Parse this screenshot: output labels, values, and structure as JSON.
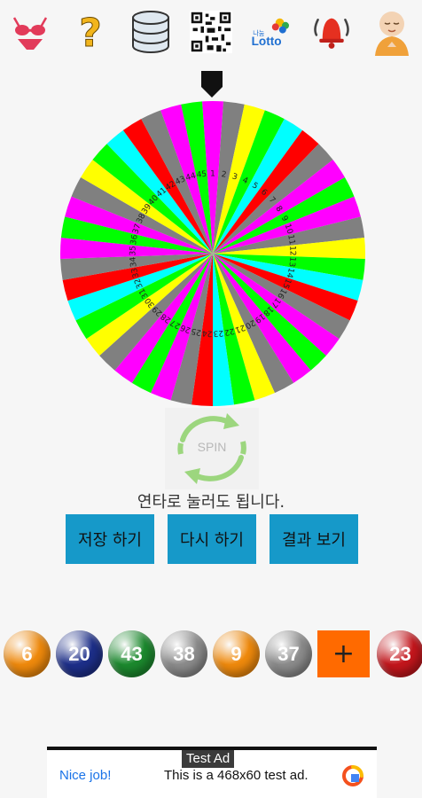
{
  "toolbar": {
    "items": [
      {
        "icon": "bikini-icon"
      },
      {
        "icon": "question-mark-icon"
      },
      {
        "icon": "database-icon"
      },
      {
        "icon": "qr-code-icon"
      },
      {
        "icon": "lotto-logo-icon",
        "label": "Lotto",
        "sublabel": "나눔"
      },
      {
        "icon": "bell-icon"
      },
      {
        "icon": "monk-icon"
      }
    ]
  },
  "wheel": {
    "numbers": [
      1,
      2,
      3,
      4,
      5,
      6,
      7,
      8,
      9,
      10,
      11,
      12,
      13,
      14,
      15,
      16,
      17,
      18,
      19,
      20,
      21,
      22,
      23,
      24,
      25,
      26,
      27,
      28,
      29,
      30,
      31,
      32,
      33,
      34,
      35,
      36,
      37,
      38,
      39,
      40,
      41,
      42,
      43,
      44,
      45
    ],
    "colors": [
      "#ff00ff",
      "#808080",
      "#ffff00",
      "#00ff00",
      "#00ffff",
      "#ff0000",
      "#808080",
      "#ff00ff",
      "#00ff00"
    ]
  },
  "spin": {
    "label": "SPIN"
  },
  "hint": "연타로 눌러도 됩니다.",
  "actions": {
    "save": "저장 하기",
    "retry": "다시 하기",
    "result": "결과 보기"
  },
  "balls": [
    {
      "number": "6",
      "color": "#f08a0c"
    },
    {
      "number": "20",
      "color": "#1d2f8a"
    },
    {
      "number": "43",
      "color": "#1c8a2e"
    },
    {
      "number": "38",
      "color": "#8c8c8c"
    },
    {
      "number": "9",
      "color": "#f08a0c"
    },
    {
      "number": "37",
      "color": "#8c8c8c"
    },
    {
      "number": "23",
      "color": "#c4161c"
    }
  ],
  "plus": "+",
  "ad": {
    "tag": "Test Ad",
    "headline": "Nice job!",
    "body": "This is a 468x60 test ad."
  },
  "accent": "#1699c9"
}
